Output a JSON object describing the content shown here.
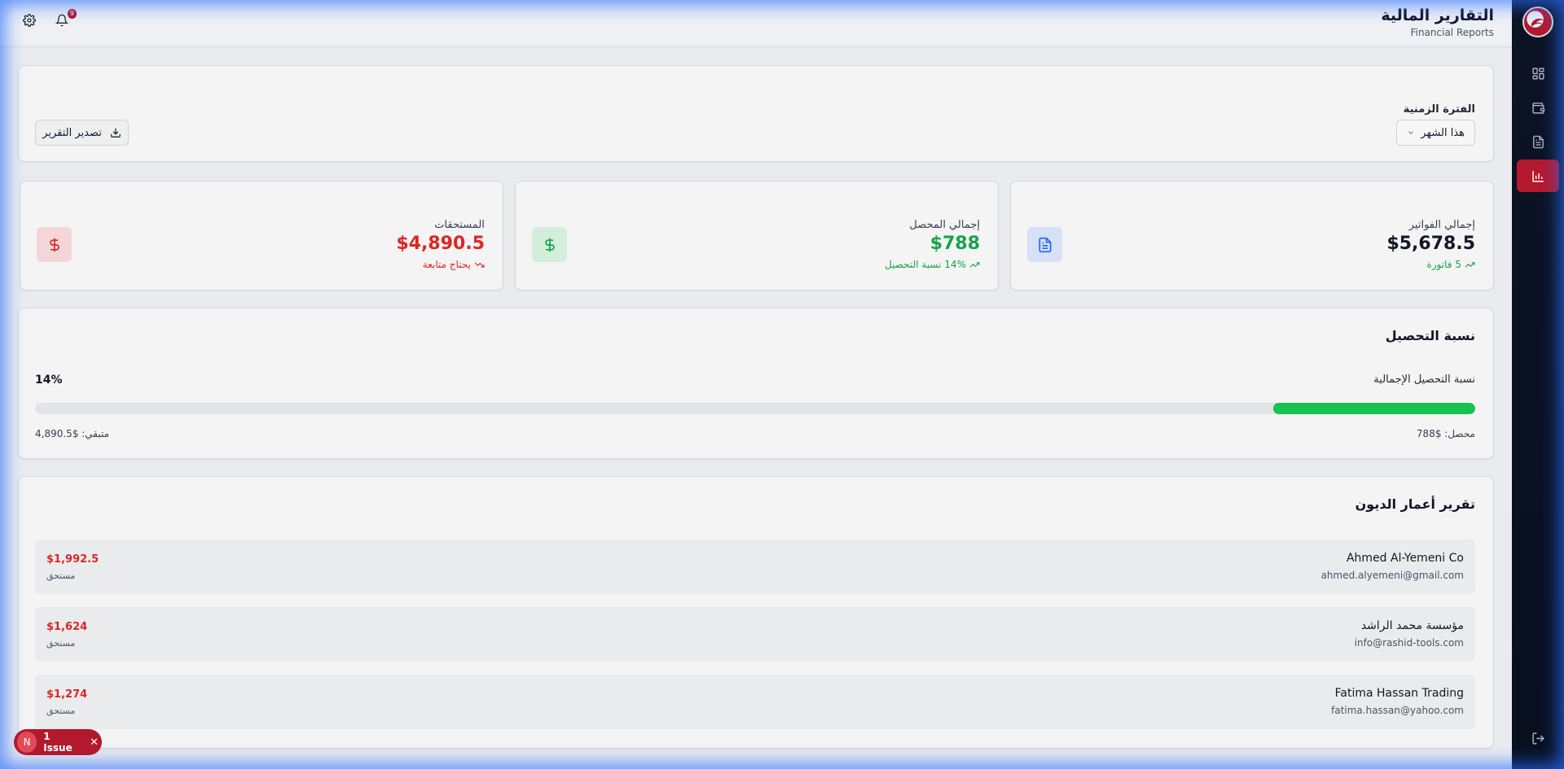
{
  "header": {
    "title": "التقارير المالية",
    "subtitle": "Financial Reports",
    "notification_count": "9"
  },
  "sidebar": {
    "items": [
      {
        "icon": "dashboard-icon"
      },
      {
        "icon": "wallet-icon"
      },
      {
        "icon": "document-icon"
      },
      {
        "icon": "chart-icon",
        "active": true
      }
    ]
  },
  "filters": {
    "period_label": "الفترة الزمنية",
    "period_value": "هذا الشهر",
    "export_label": "تصدير التقرير"
  },
  "stats": {
    "invoices": {
      "label": "إجمالي الفواتير",
      "value": "$5,678.5",
      "sub": "5 فاتورة"
    },
    "collected": {
      "label": "إجمالي المحصل",
      "value": "$788",
      "sub": "14% نسبة التحصيل"
    },
    "receivables": {
      "label": "المستحقات",
      "value": "$4,890.5",
      "sub": "يحتاج متابعة"
    }
  },
  "collection_rate": {
    "title": "نسبة التحصيل",
    "label": "نسبة التحصيل الإجمالية",
    "percent_text": "14%",
    "percent": 14,
    "collected_text": "محصل: $788",
    "remaining_text": "متبقي: $4,890.5"
  },
  "aging": {
    "title": "تقرير أعمار الديون",
    "rows": [
      {
        "name": "Ahmed Al-Yemeni Co",
        "email": "ahmed.alyemeni@gmail.com",
        "amount": "$1,992.5",
        "tag": "مستحق"
      },
      {
        "name": "مؤسسة محمد الراشد",
        "email": "info@rashid-tools.com",
        "amount": "$1,624",
        "tag": "مستحق"
      },
      {
        "name": "Fatima Hassan Trading",
        "email": "fatima.hassan@yahoo.com",
        "amount": "$1,274",
        "tag": "مستحق"
      }
    ]
  },
  "issue": {
    "initial": "N",
    "label": "1 Issue"
  },
  "colors": {
    "accent": "#b3192c",
    "success": "#16a34a",
    "danger": "#dc2626",
    "info": "#2563eb"
  }
}
